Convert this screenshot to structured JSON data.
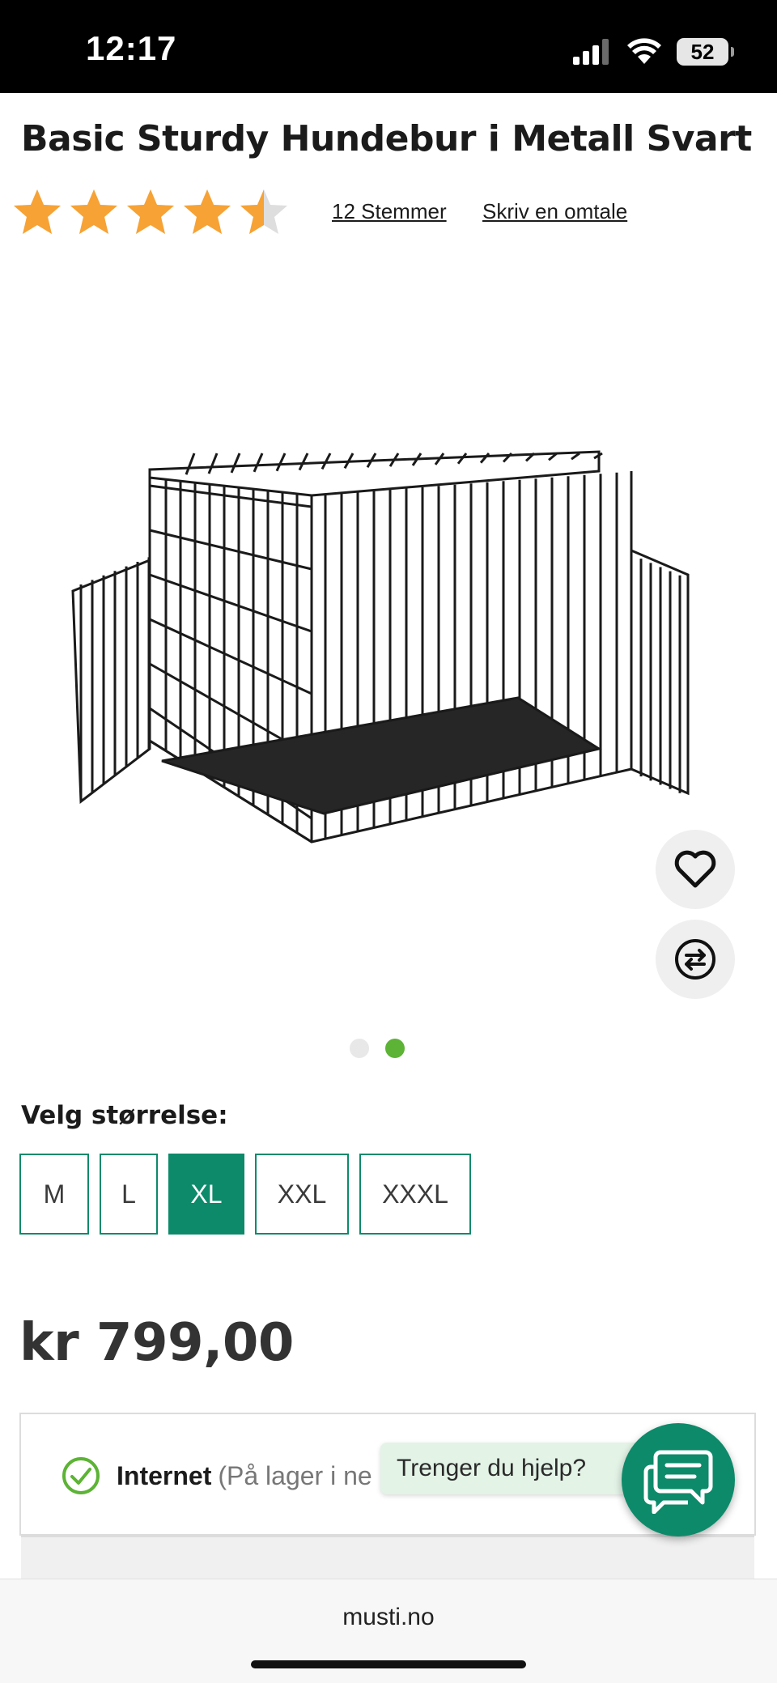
{
  "status_bar": {
    "time": "12:17",
    "battery": "52"
  },
  "product": {
    "title": "Basic Sturdy Hundebur i Metall Svart",
    "rating": {
      "value": 4.5,
      "max": 5,
      "votes_link": "12 Stemmer",
      "review_link": "Skriv en omtale"
    },
    "carousel": {
      "count": 2,
      "active_index": 1
    },
    "size_label": "Velg størrelse:",
    "sizes": [
      {
        "label": "M",
        "selected": false
      },
      {
        "label": "L",
        "selected": false
      },
      {
        "label": "XL",
        "selected": true
      },
      {
        "label": "XXL",
        "selected": false
      },
      {
        "label": "XXXL",
        "selected": false
      }
    ],
    "price": "kr 799,00",
    "stock": {
      "channel": "Internet",
      "status": "(På lager i ne"
    }
  },
  "help": {
    "bubble": "Trenger du hjelp?"
  },
  "browser": {
    "url": "musti.no"
  },
  "colors": {
    "accent": "#0d8a6a",
    "star": "#f7a234",
    "dot_active": "#5cb335"
  }
}
